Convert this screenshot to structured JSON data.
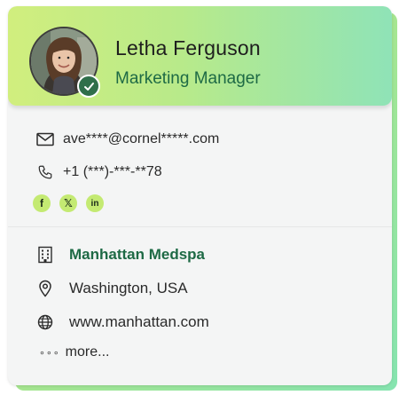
{
  "profile": {
    "name": "Letha Ferguson",
    "title": "Marketing Manager",
    "verified": true
  },
  "contact": {
    "email": "ave****@cornel*****.com",
    "phone": "+1 (***)-***-**78"
  },
  "socials": [
    {
      "icon": "facebook-icon",
      "glyph": "f"
    },
    {
      "icon": "x-twitter-icon",
      "glyph": "𝕏"
    },
    {
      "icon": "linkedin-icon",
      "glyph": "in"
    }
  ],
  "company": {
    "name": "Manhattan Medspa",
    "location": "Washington, USA",
    "website": "www.manhattan.com"
  },
  "more_label": "more...",
  "colors": {
    "accent_green": "#1e6a45",
    "header_gradient_start": "#d1ee7e",
    "header_gradient_end": "#8fe3b7",
    "social_badge": "#c4ea72"
  }
}
